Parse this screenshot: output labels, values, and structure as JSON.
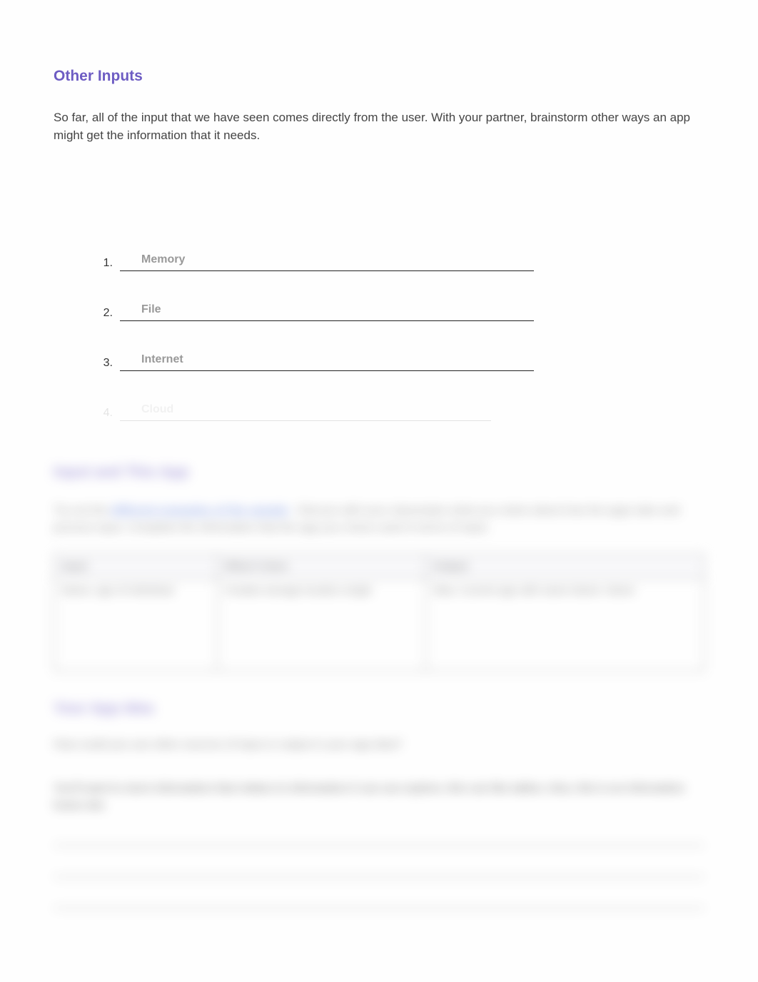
{
  "sections": {
    "other_inputs": {
      "title": "Other Inputs",
      "intro": "So far, all of the input that we have seen comes directly from the user. With your partner, brainstorm other ways an app might get the information that it needs.",
      "items": [
        {
          "num": "1.",
          "answer": "Memory"
        },
        {
          "num": "2.",
          "answer": "File"
        },
        {
          "num": "3.",
          "answer": "Internet"
        },
        {
          "num": "4.",
          "answer": "Cloud"
        }
      ]
    },
    "input_and_this_app": {
      "title": "Input and This App",
      "para_prefix": "Try out the ",
      "link_text": "different examples of the sample",
      "para_suffix": ". Discuss with your classmates what you notice about how the apps take and process input. Complete the information that the app you chose used in terms of input.",
      "table": {
        "headers": [
          "Input",
          "What it does",
          "Output"
        ],
        "row": {
          "input": "Name, age of individual",
          "what": "Creates storage location single",
          "output": "Was: Current age with name\nName: Name"
        }
      }
    },
    "your_app_idea": {
      "title": "Your App Idea",
      "question": "How could you use other sources of input or output in your app idea?",
      "answer_lead": "You'll want to store information that relates to information it can use explore, this can like tables. Also, this is an informative home site."
    }
  }
}
